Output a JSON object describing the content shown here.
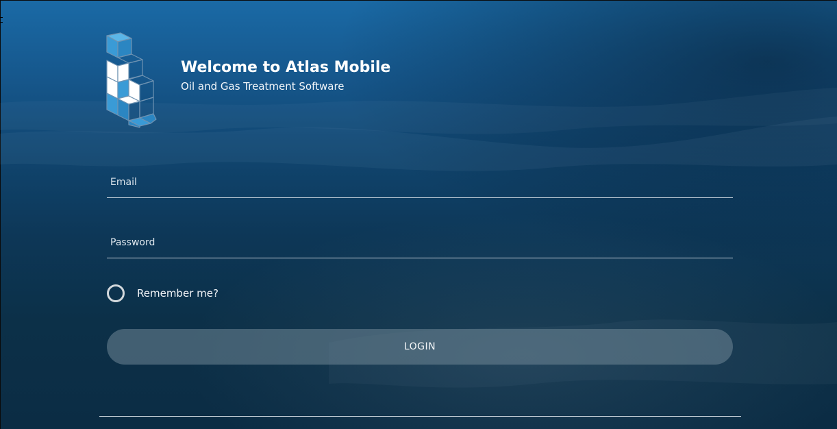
{
  "header": {
    "title": "Welcome to Atlas Mobile",
    "subtitle": "Oil and Gas Treatment Software"
  },
  "logo": {
    "icon": "stacked-cubes-logo-icon",
    "colors": {
      "light_blue": "#4aa7dd",
      "mid_blue": "#2f8cc9",
      "white": "#ffffff",
      "outline": "#5f86a6"
    }
  },
  "form": {
    "email": {
      "placeholder": "Email",
      "value": ""
    },
    "password": {
      "placeholder": "Password",
      "value": ""
    },
    "remember": {
      "label": "Remember me?",
      "checked": false
    },
    "login_label": "LOGIN"
  },
  "colors": {
    "background_top": "#1a6aa6",
    "background_bottom": "#0b2c44",
    "button": "#708796",
    "underline": "#c9d3dc"
  }
}
